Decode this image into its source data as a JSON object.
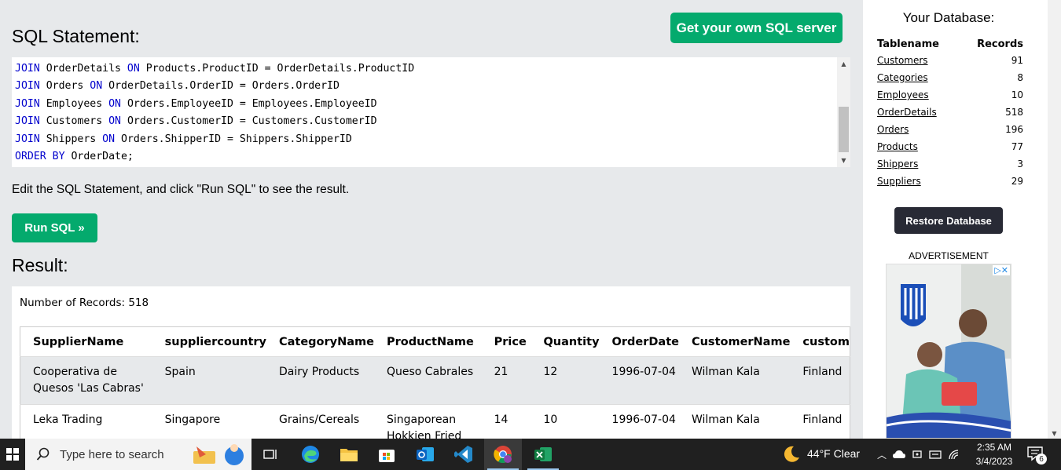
{
  "header": {
    "own_server_label": "Get your own SQL server",
    "sql_heading": "SQL Statement:"
  },
  "code_lines": [
    [
      {
        "k": "JOIN"
      },
      {
        "t": " OrderDetails "
      },
      {
        "k": "ON"
      },
      {
        "t": " Products.ProductID = OrderDetails.ProductID"
      }
    ],
    [
      {
        "k": "JOIN"
      },
      {
        "t": " Orders "
      },
      {
        "k": "ON"
      },
      {
        "t": " OrderDetails.OrderID = Orders.OrderID"
      }
    ],
    [
      {
        "k": "JOIN"
      },
      {
        "t": " Employees "
      },
      {
        "k": "ON"
      },
      {
        "t": " Orders.EmployeeID = Employees.EmployeeID"
      }
    ],
    [
      {
        "k": "JOIN"
      },
      {
        "t": " Customers "
      },
      {
        "k": "ON"
      },
      {
        "t": " Orders.CustomerID = Customers.CustomerID"
      }
    ],
    [
      {
        "k": "JOIN"
      },
      {
        "t": " Shippers "
      },
      {
        "k": "ON"
      },
      {
        "t": " Orders.ShipperID = Shippers.ShipperID"
      }
    ],
    [
      {
        "k": "ORDER BY"
      },
      {
        "t": " OrderDate;"
      }
    ]
  ],
  "hint": "Edit the SQL Statement, and click \"Run SQL\" to see the result.",
  "run_label": "Run SQL »",
  "result_heading": "Result:",
  "record_count": "Number of Records: 518",
  "result_table": {
    "columns": [
      "SupplierName",
      "suppliercountry",
      "CategoryName",
      "ProductName",
      "Price",
      "Quantity",
      "OrderDate",
      "CustomerName",
      "custom"
    ],
    "rows": [
      [
        "Cooperativa de Quesos 'Las Cabras'",
        "Spain",
        "Dairy Products",
        "Queso Cabrales",
        "21",
        "12",
        "1996-07-04",
        "Wilman Kala",
        "Finland"
      ],
      [
        "Leka Trading",
        "Singapore",
        "Grains/Cereals",
        "Singaporean Hokkien Fried",
        "14",
        "10",
        "1996-07-04",
        "Wilman Kala",
        "Finland"
      ]
    ]
  },
  "sidebar": {
    "title": "Your Database:",
    "col_table": "Tablename",
    "col_records": "Records",
    "tables": [
      {
        "name": "Customers",
        "records": "91"
      },
      {
        "name": "Categories",
        "records": "8"
      },
      {
        "name": "Employees",
        "records": "10"
      },
      {
        "name": "OrderDetails",
        "records": "518"
      },
      {
        "name": "Orders",
        "records": "196"
      },
      {
        "name": "Products",
        "records": "77"
      },
      {
        "name": "Shippers",
        "records": "3"
      },
      {
        "name": "Suppliers",
        "records": "29"
      }
    ],
    "restore_label": "Restore Database",
    "ad_label": "ADVERTISEMENT"
  },
  "taskbar": {
    "search_placeholder": "Type here to search",
    "weather": "44°F  Clear",
    "time": "2:35 AM",
    "date": "3/4/2023",
    "notification_count": "6"
  },
  "colors": {
    "accent_green": "#04aa6d",
    "dark_button": "#282a35",
    "keyword_blue": "#0000cd"
  }
}
